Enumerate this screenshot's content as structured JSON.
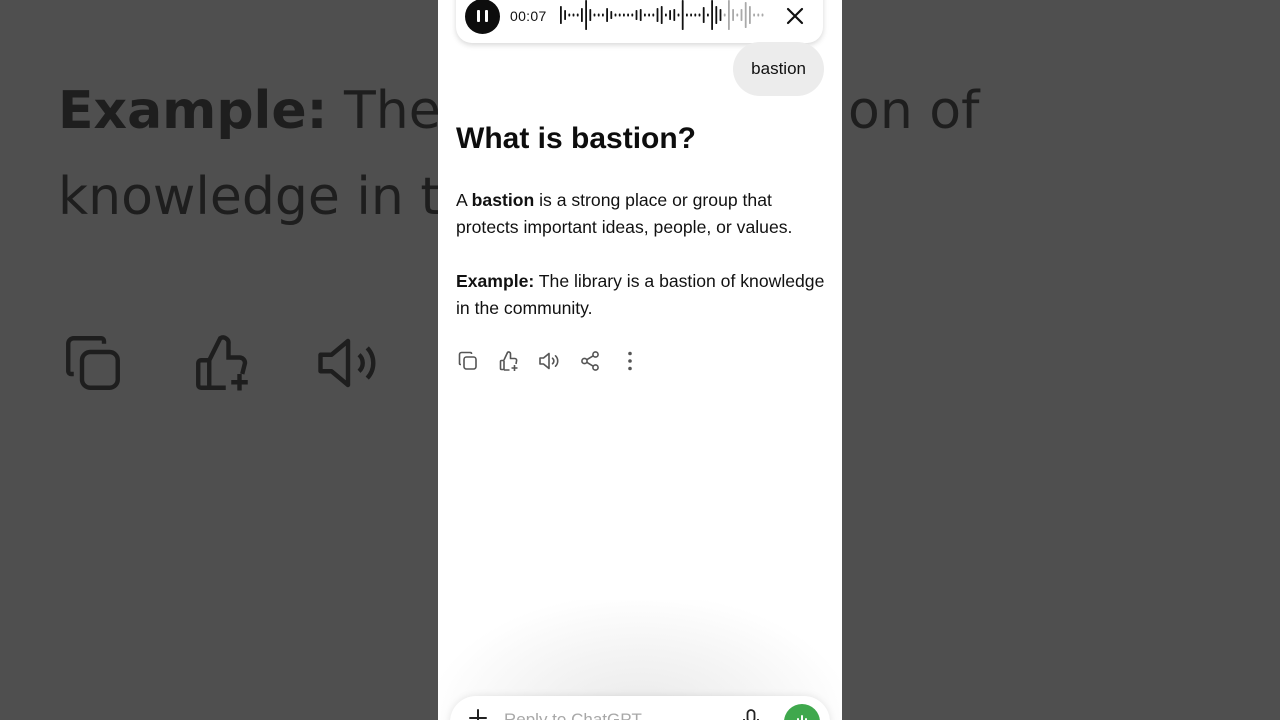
{
  "backdrop": {
    "line1_bold": "Example:",
    "line1_rest": " The li",
    "line1_tail": "on of",
    "line2": "knowledge in th"
  },
  "audio": {
    "time": "00:07",
    "pause_icon": "pause-icon",
    "close_icon": "close-icon"
  },
  "chat": {
    "user_message": "bastion",
    "title": "What is bastion?",
    "definition": {
      "prefix": "A ",
      "term": "bastion",
      "rest": " is a strong place or group that protects important ideas, people, or values."
    },
    "example": {
      "label": "Example:",
      "text": " The library is a bastion of knowledge in the community."
    }
  },
  "actions": {
    "icons": [
      "copy-icon",
      "thumbs-up-icon",
      "speaker-icon",
      "share-icon",
      "more-icon"
    ]
  },
  "composer": {
    "placeholder": "Reply to ChatGPT",
    "plus_icon": "plus-icon",
    "mic_icon": "mic-icon",
    "voice_icon": "voice-mode-icon",
    "voice_color": "#3fa84d"
  }
}
